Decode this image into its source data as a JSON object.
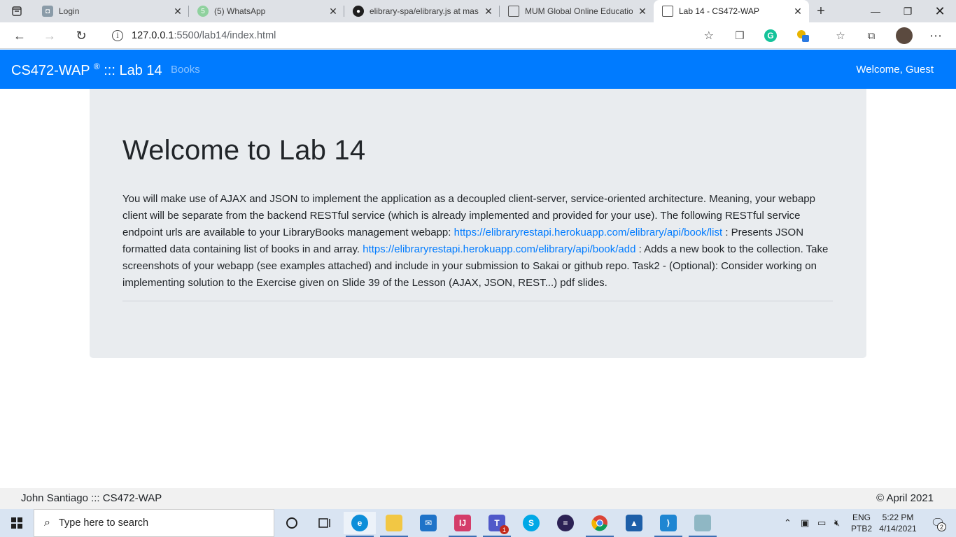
{
  "browser": {
    "tabs": [
      {
        "title": "Login",
        "favicon": "login-icon",
        "color": "#8a9ba8"
      },
      {
        "title": "(5) WhatsApp",
        "favicon": "whatsapp-icon",
        "color": "#25d366"
      },
      {
        "title": "elibrary-spa/elibrary.js at mas",
        "favicon": "github-icon",
        "color": "#1f1f1f"
      },
      {
        "title": "MUM Global Online Educatio",
        "favicon": "document-icon",
        "color": "#555555"
      },
      {
        "title": "Lab 14 - CS472-WAP",
        "favicon": "document-icon",
        "color": "#555555",
        "active": true
      }
    ],
    "url_host": "127.0.0.1",
    "url_path": ":5500/lab14/index.html"
  },
  "page": {
    "brand": "CS472-WAP",
    "brand_mark": "®",
    "brand_suffix": "::: Lab 14",
    "nav_books": "Books",
    "welcome": "Welcome, Guest",
    "heading": "Welcome to Lab 14",
    "lead_1": "You will make use of AJAX and JSON to implement the application as a decoupled client-server, service-oriented architecture. Meaning, your webapp client will be separate from the backend RESTful service (which is already implemented and provided for your use). The following RESTful service endpoint urls are available to your LibraryBooks management webapp: ",
    "link_list": "https://elibraryrestapi.herokuapp.com/elibrary/api/book/list",
    "lead_2": " : Presents JSON formatted data containing list of books in and array. ",
    "link_add": "https://elibraryrestapi.herokuapp.com/elibrary/api/book/add",
    "lead_3": " : Adds a new book to the collection. Take screenshots of your webapp (see examples attached) and include in your submission to Sakai or github repo. Task2 - (Optional): Consider working on implementing solution to the Exercise given on Slide 39 of the Lesson (AJAX, JSON, REST...) pdf slides.",
    "footer_left": "John Santiago ::: CS472-WAP",
    "footer_right": "© April 2021"
  },
  "colors": {
    "navbar": "#007bff",
    "jumbotron": "#e9ecef",
    "link": "#007bff"
  },
  "taskbar": {
    "search_placeholder": "Type here to search",
    "teams_badge": "1",
    "lang_top": "ENG",
    "lang_bottom": "PTB2",
    "time": "5:22 PM",
    "date": "4/14/2021",
    "notifications": "2"
  }
}
